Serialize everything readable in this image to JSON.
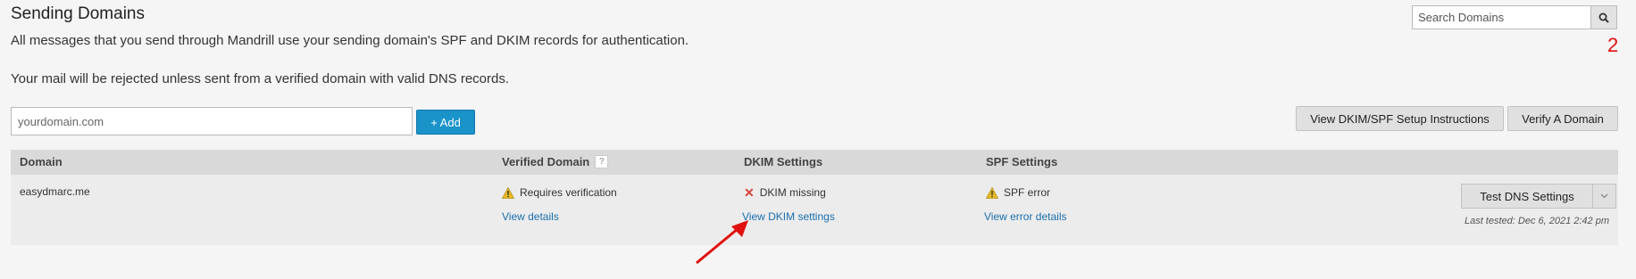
{
  "header": {
    "title": "Sending Domains",
    "description_1": "All messages that you send through Mandrill use your sending domain's SPF and DKIM records for authentication.",
    "description_2": "Your mail will be rejected unless sent from a verified domain with valid DNS records."
  },
  "search": {
    "placeholder": "Search Domains",
    "icon": "search-icon"
  },
  "annotation": {
    "number": "2",
    "color": "#e01010"
  },
  "add_domain": {
    "placeholder": "yourdomain.com",
    "value": "",
    "button_label": "+ Add"
  },
  "actions": {
    "instructions_label": "View DKIM/SPF Setup Instructions",
    "verify_label": "Verify A Domain"
  },
  "table": {
    "columns": [
      "Domain",
      "Verified Domain",
      "DKIM Settings",
      "SPF Settings"
    ],
    "help_icon": "?",
    "rows": [
      {
        "domain": "easydmarc.me",
        "verified_status": "Requires verification",
        "verified_link": "View details",
        "dkim_status": "DKIM missing",
        "dkim_link": "View DKIM settings",
        "spf_status": "SPF error",
        "spf_link": "View error details",
        "test_button": "Test DNS Settings",
        "last_tested": "Last tested: Dec 6, 2021 2:42 pm"
      }
    ]
  },
  "colors": {
    "accent": "#1a93c9",
    "link": "#1a6fae",
    "warning": "#e8b923",
    "error": "#d9443b"
  }
}
